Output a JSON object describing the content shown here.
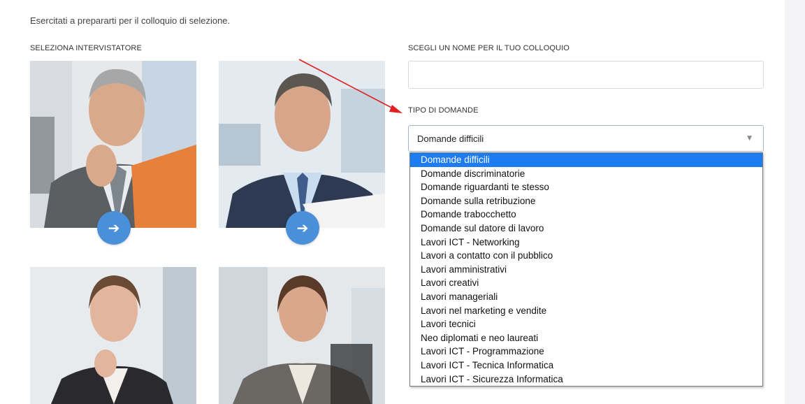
{
  "intro_text": "Esercitati a prepararti per il colloquio di selezione.",
  "interviewer_section": {
    "label": "SELEZIONA INTERVISTATORE",
    "cards": [
      {
        "button_icon": "arrow-right-icon",
        "button_glyph": "➔"
      },
      {
        "button_icon": "arrow-right-icon",
        "button_glyph": "➔"
      },
      {},
      {}
    ]
  },
  "interview_name": {
    "label": "SCEGLI UN NOME PER IL TUO COLLOQUIO",
    "value": "",
    "placeholder": ""
  },
  "question_type": {
    "label": "TIPO DI DOMANDE",
    "selected": "Domande difficili",
    "caret": "▼",
    "options": [
      "Domande difficili",
      "Domande discriminatorie",
      "Domande riguardanti te stesso",
      "Domande sulla retribuzione",
      "Domande trabocchetto",
      "Domande sul datore di lavoro",
      "Lavori ICT - Networking",
      "Lavori a contatto con il pubblico",
      "Lavori amministrativi",
      "Lavori creativi",
      "Lavori manageriali",
      "Lavori nel marketing e vendite",
      "Lavori tecnici",
      "Neo diplomati e neo laureati",
      "Lavori ICT - Programmazione",
      "Lavori ICT - Tecnica Informatica",
      "Lavori ICT - Sicurezza Informatica"
    ],
    "highlighted_index": 0
  },
  "colors": {
    "accent_button": "#4a90d9",
    "highlight": "#1e7cf2",
    "annotation_arrow": "#e02020"
  }
}
